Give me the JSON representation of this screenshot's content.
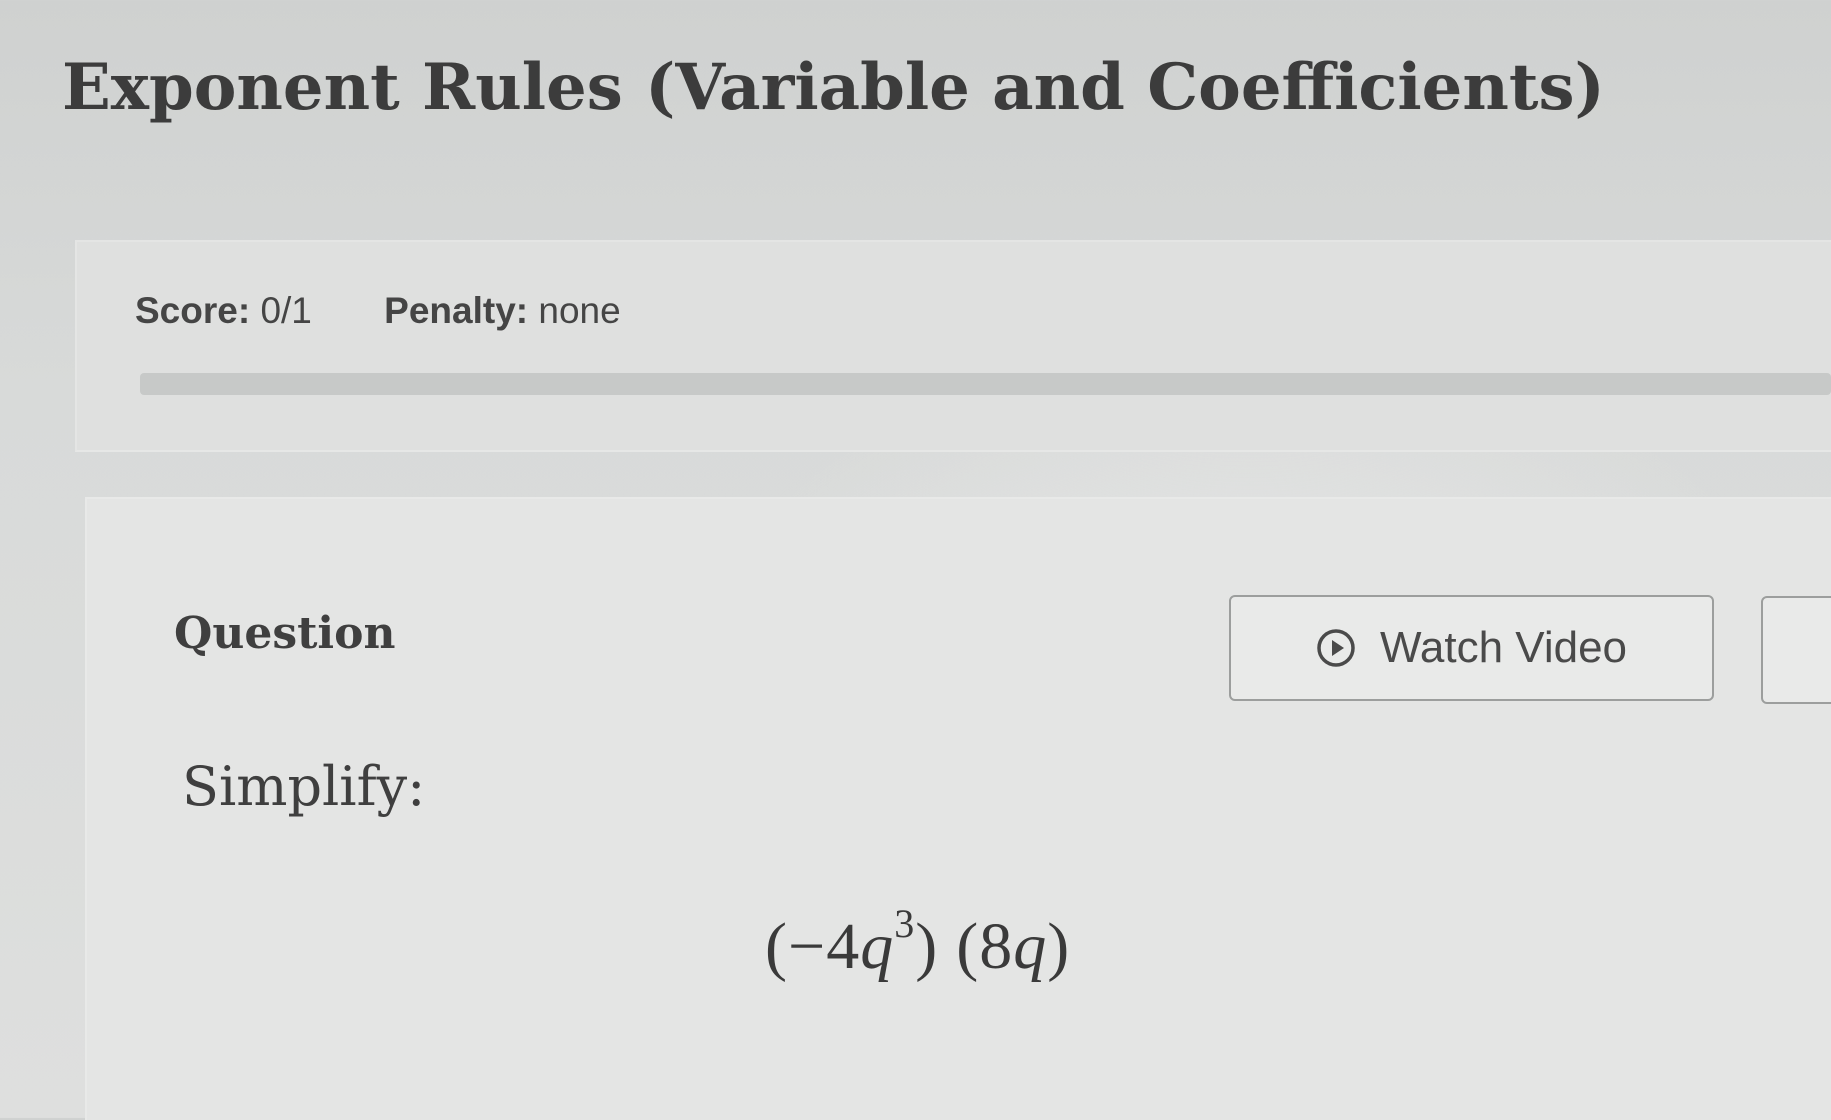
{
  "page": {
    "title": "Exponent Rules (Variable and Coefficients)"
  },
  "score_panel": {
    "score_key": "Score:",
    "score_value": "0/1",
    "penalty_key": "Penalty:",
    "penalty_value": "none",
    "progress": 0
  },
  "question": {
    "label": "Question",
    "watch_video_label": "Watch Video",
    "watch_video_icon": "play-circle-icon",
    "prompt": "Simplify:",
    "expression": {
      "open_paren_1": "(",
      "minus": "−",
      "coef_1": "4",
      "var_1": "q",
      "exp_1": "3",
      "close_paren_1": ")",
      "open_paren_2": "(",
      "coef_2": "8",
      "var_2": "q",
      "close_paren_2": ")"
    }
  },
  "colors": {
    "background": "#d6d8d7",
    "text_dark": "#3c3c3c",
    "border": "#9c9e9d"
  }
}
